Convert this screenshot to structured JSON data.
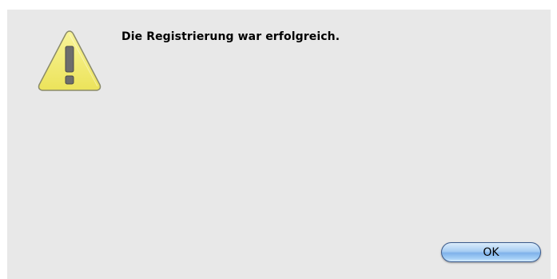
{
  "dialog": {
    "message": "Die Registrierung war erfolgreich.",
    "icon": "warning-triangle-icon",
    "ok_label": "OK"
  },
  "colors": {
    "dialog_background": "#e8e8e8",
    "icon_fill": "#f4ee78",
    "button_accent": "#7fb2ea"
  }
}
